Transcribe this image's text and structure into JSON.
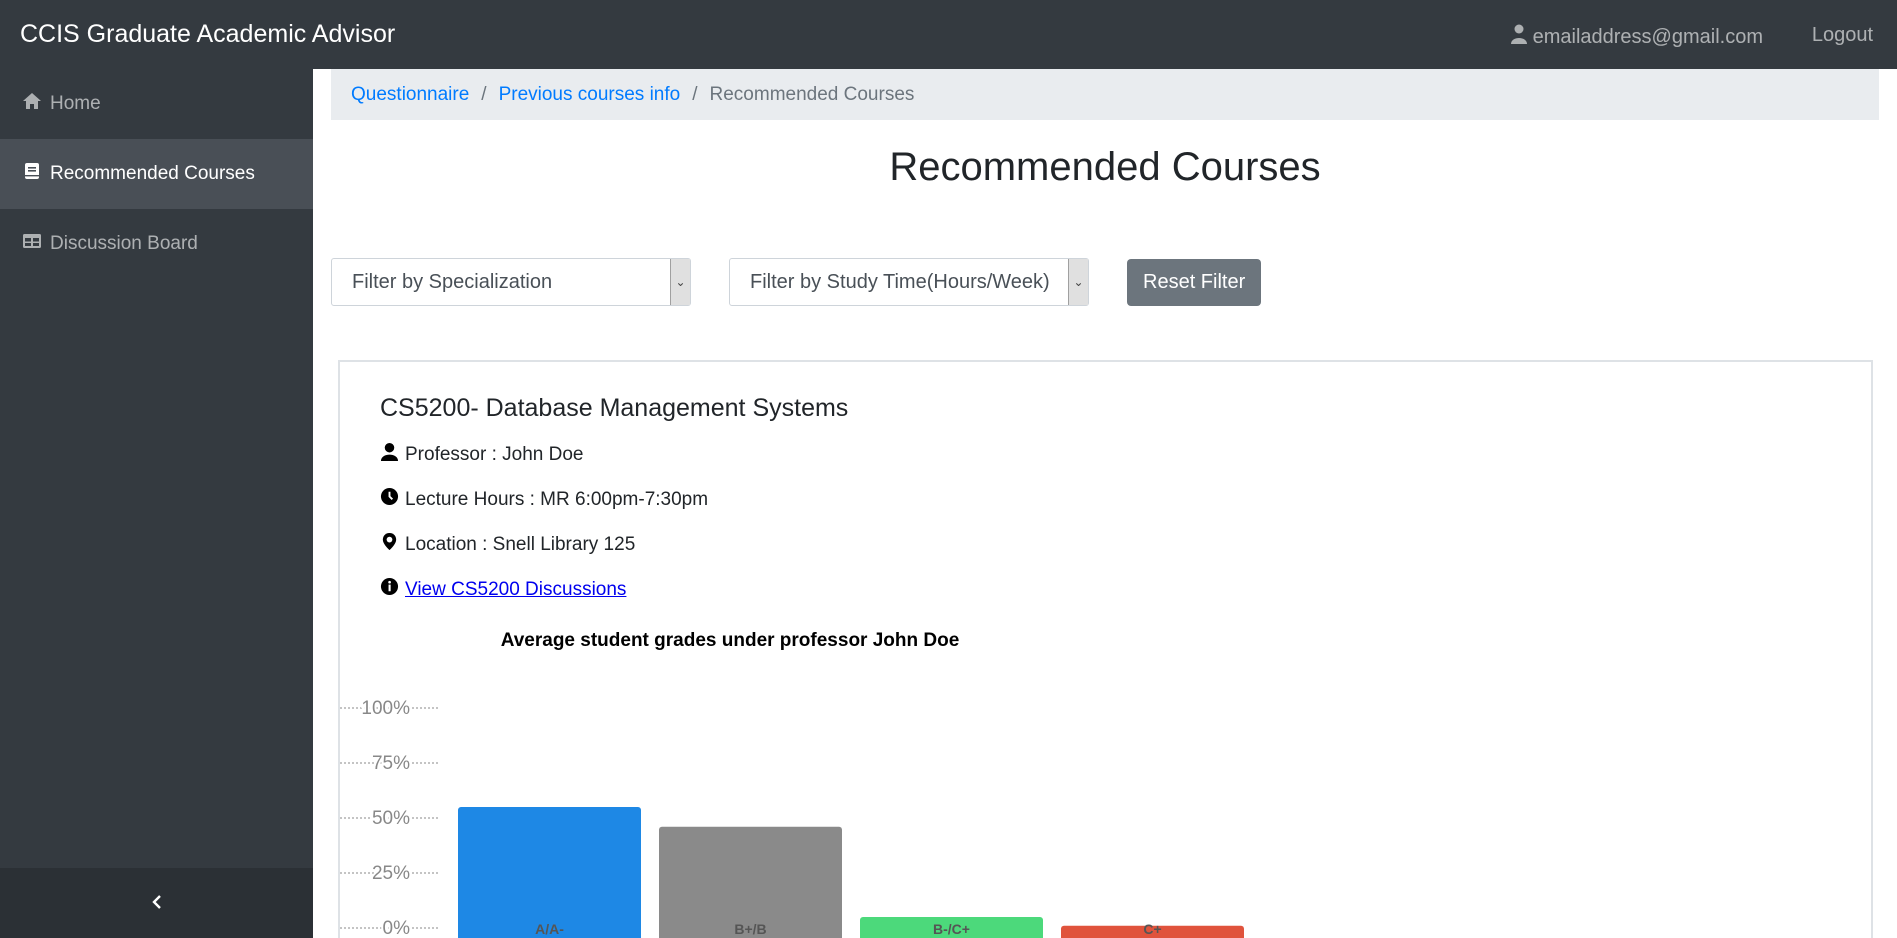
{
  "app": {
    "brand": "CCIS Graduate Academic Advisor",
    "user_email": "emailaddress@gmail.com",
    "logout_label": "Logout"
  },
  "sidebar": {
    "items": [
      {
        "label": "Home",
        "icon": "home-icon",
        "active": false
      },
      {
        "label": "Recommended Courses",
        "icon": "book-icon",
        "active": true
      },
      {
        "label": "Discussion Board",
        "icon": "table-icon",
        "active": false
      }
    ],
    "collapse_icon": "chevron-left-icon"
  },
  "breadcrumb": {
    "items": [
      "Questionnaire",
      "Previous courses info"
    ],
    "current": "Recommended Courses"
  },
  "page": {
    "title": "Recommended Courses"
  },
  "filters": {
    "specialization_value": "Filter by Specialization",
    "study_time_value": "Filter by Study Time(Hours/Week)",
    "reset_label": "Reset Filter"
  },
  "course": {
    "title": "CS5200- Database Management Systems",
    "professor": "Professor : John Doe",
    "lecture_hours": "Lecture Hours : MR 6:00pm-7:30pm",
    "location": "Location : Snell Library 125",
    "discussions_link": "View CS5200 Discussions"
  },
  "chart_data": {
    "type": "bar",
    "title": "Average student grades under professor John Doe",
    "categories": [
      "A/A-",
      "B+/B",
      "B-/C+",
      "C+"
    ],
    "values": [
      55,
      46,
      5,
      1
    ],
    "colors": [
      "#1e88e5",
      "#8a8a8a",
      "#4cd97b",
      "#e0533c"
    ],
    "ylim": [
      0,
      100
    ],
    "yticks": [
      "0%",
      "25%",
      "50%",
      "75%",
      "100%"
    ],
    "xlabel": "",
    "ylabel": "",
    "grid": true
  }
}
